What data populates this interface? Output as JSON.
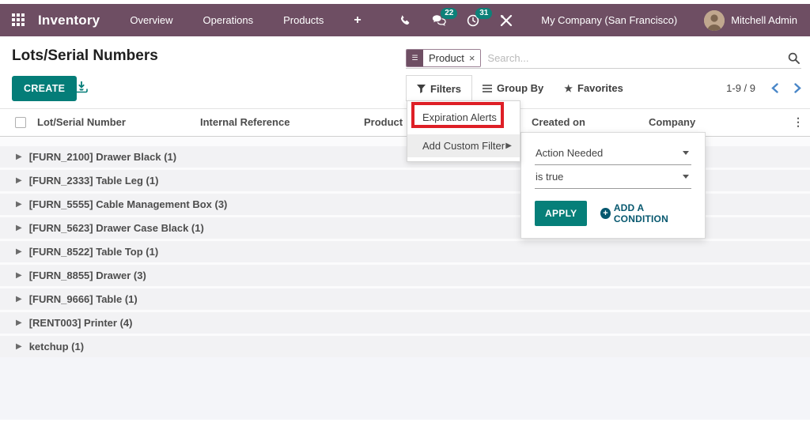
{
  "topbar": {
    "app_name": "Inventory",
    "menus": [
      "Overview",
      "Operations",
      "Products"
    ],
    "plus_label": "+",
    "chat_badge": "22",
    "activity_badge": "31",
    "company": "My Company (San Francisco)",
    "user": "Mitchell Admin"
  },
  "control_panel": {
    "title": "Lots/Serial Numbers",
    "create_label": "CREATE",
    "search": {
      "facet_label": "Product",
      "placeholder": "Search..."
    },
    "filters_label": "Filters",
    "groupby_label": "Group By",
    "favorites_label": "Favorites",
    "pager_text": "1-9 / 9"
  },
  "filters_menu": {
    "expiration_alerts": "Expiration Alerts",
    "add_custom_filter": "Add Custom Filter"
  },
  "custom_filter_panel": {
    "field_value": "Action Needed",
    "operator_value": "is true",
    "apply_label": "APPLY",
    "add_condition_label": "ADD A CONDITION"
  },
  "table": {
    "headers": [
      "Lot/Serial Number",
      "Internal Reference",
      "Product",
      "Created on",
      "Company"
    ],
    "rows": [
      "[FURN_2100] Drawer Black (1)",
      "[FURN_2333] Table Leg (1)",
      "[FURN_5555] Cable Management Box (3)",
      "[FURN_5623] Drawer Case Black (1)",
      "[FURN_8522] Table Top (1)",
      "[FURN_8855] Drawer (3)",
      "[FURN_9666] Table (1)",
      "[RENT003] Printer (4)",
      "ketchup (1)"
    ]
  },
  "colors": {
    "topbar_purple": "#6e4e63",
    "accent_teal": "#047d78",
    "badge_teal": "#0d8179",
    "annotation_red": "#de1f26",
    "link_dark_teal": "#07586f",
    "pager_blue": "#4a87c8"
  }
}
